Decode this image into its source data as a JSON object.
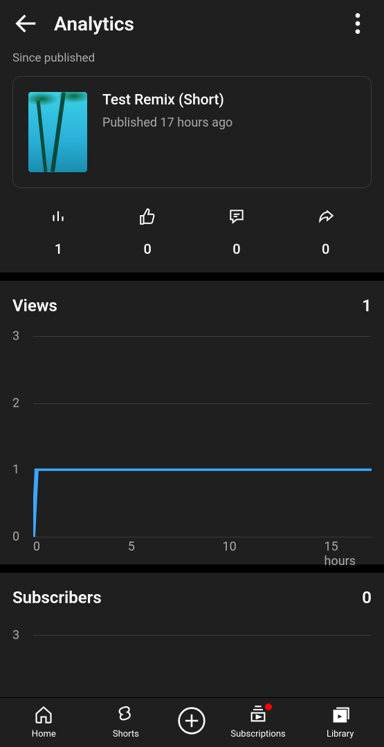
{
  "header": {
    "title": "Analytics"
  },
  "since_label": "Since published",
  "video": {
    "title": "Test Remix (Short)",
    "published": "Published 17 hours ago"
  },
  "stats": {
    "views": "1",
    "likes": "0",
    "comments": "0",
    "shares": "0"
  },
  "views_section": {
    "title": "Views",
    "total": "1"
  },
  "subs_section": {
    "title": "Subscribers",
    "total": "0",
    "y_tick": "3"
  },
  "chart_data": {
    "type": "line",
    "title": "Views",
    "xlabel": "hours",
    "ylabel": "",
    "ylim": [
      0,
      3
    ],
    "y_ticks": [
      "0",
      "1",
      "2",
      "3"
    ],
    "x_ticks": [
      "0",
      "5",
      "10",
      "15 hours"
    ],
    "series": [
      {
        "name": "Views",
        "x": [
          0,
          0.2,
          17
        ],
        "values": [
          0,
          1,
          1
        ]
      }
    ]
  },
  "nav": {
    "home": "Home",
    "shorts": "Shorts",
    "subscriptions": "Subscriptions",
    "library": "Library"
  },
  "colors": {
    "accent": "#3ea6ff",
    "badge": "#ff0000"
  }
}
